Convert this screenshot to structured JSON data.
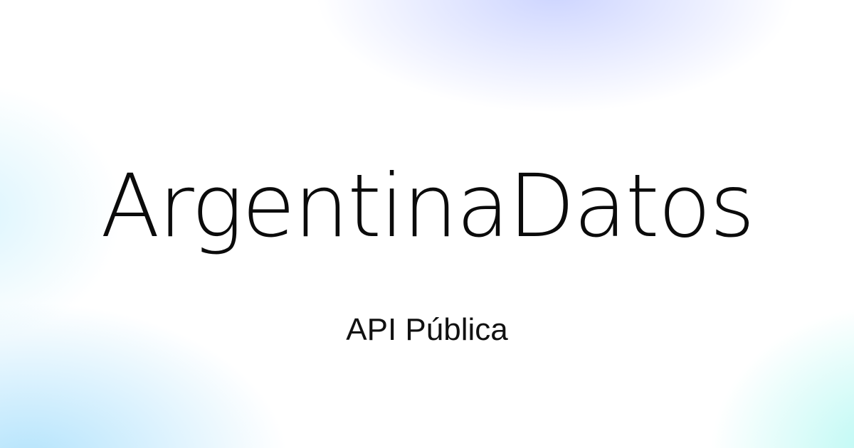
{
  "hero": {
    "title": "ArgentinaDatos",
    "subtitle": "API Pública"
  }
}
